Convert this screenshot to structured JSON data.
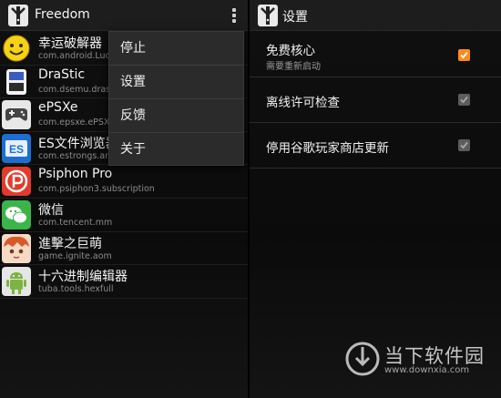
{
  "left": {
    "title": "Freedom",
    "apps": [
      {
        "name": "幸运破解器",
        "package": "com.android.Lucky",
        "icon": "smiley-icon"
      },
      {
        "name": "DraStic",
        "package": "com.dsemu.drastic",
        "icon": "handheld-console-icon"
      },
      {
        "name": "ePSXe",
        "package": "com.epsxe.ePSXe",
        "icon": "gamepad-icon"
      },
      {
        "name": "ES文件浏览器",
        "package": "com.estrongs.andr",
        "icon": "es-explorer-icon"
      },
      {
        "name": "Psiphon Pro",
        "package": "com.psiphon3.subscription",
        "icon": "psiphon-icon"
      },
      {
        "name": "微信",
        "package": "com.tencent.mm",
        "icon": "wechat-icon"
      },
      {
        "name": "進擊之巨萌",
        "package": "game.ignite.aom",
        "icon": "anime-character-icon"
      },
      {
        "name": "十六进制编辑器",
        "package": "tuba.tools.hexfull",
        "icon": "android-robot-icon"
      }
    ],
    "menu": [
      "停止",
      "设置",
      "反馈",
      "关于"
    ]
  },
  "right": {
    "title": "设置",
    "settings": [
      {
        "title": "免费核心",
        "subtitle": "需要重新启动",
        "checked": true
      },
      {
        "title": "离线许可检查",
        "subtitle": "",
        "checked": true
      },
      {
        "title": "停用谷歌玩家商店更新",
        "subtitle": "",
        "checked": true
      }
    ]
  },
  "watermark": {
    "name": "当下软件园",
    "url": "www.downxia.com"
  },
  "colors": {
    "checked_box": "#ff8a1c",
    "background": "#0f0f0f",
    "popup": "#2b2b2b"
  }
}
